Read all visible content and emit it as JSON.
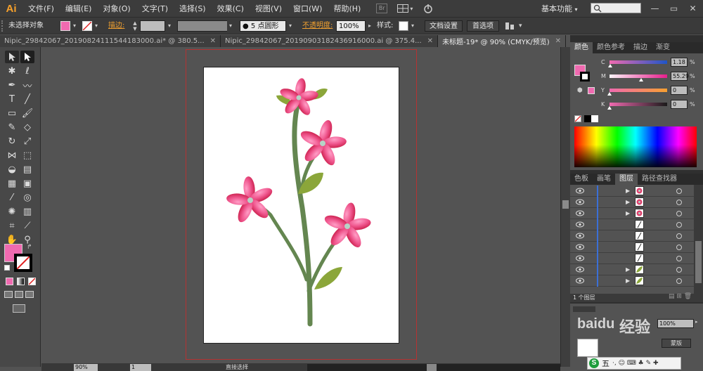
{
  "app": {
    "logo": "Ai",
    "workspace": "基本功能"
  },
  "menubar": {
    "items": [
      "文件(F)",
      "编辑(E)",
      "对象(O)",
      "文字(T)",
      "选择(S)",
      "效果(C)",
      "视图(V)",
      "窗口(W)",
      "帮助(H)"
    ],
    "bridge_label": "Br"
  },
  "window_buttons": {
    "minimize": "—",
    "restore": "▭",
    "close": "✕"
  },
  "control_bar": {
    "selection_label": "未选择对象",
    "stroke_label": "描边:",
    "brush_label": "5 点圆形",
    "opacity_label": "不透明度:",
    "opacity_value": "100%",
    "style_label": "样式:",
    "doc_setup_button": "文档设置",
    "preferences_button": "首选项"
  },
  "tabs": [
    {
      "label": "Nipic_29842067_20190824111544183000.ai* @ 380.5...",
      "active": false
    },
    {
      "label": "Nipic_29842067_20190903182436916000.ai @ 375.4...",
      "active": false
    },
    {
      "label": "未标题-19* @ 90% (CMYK/预览)",
      "active": true
    }
  ],
  "color_panel": {
    "tabs": [
      "颜色",
      "颜色参考",
      "描边",
      "渐变"
    ],
    "channels": [
      {
        "label": "C",
        "value": "1.18",
        "unit": "%",
        "level": 0.0118
      },
      {
        "label": "M",
        "value": "55.29",
        "unit": "%",
        "level": 0.5529
      },
      {
        "label": "Y",
        "value": "0",
        "unit": "%",
        "level": 0
      },
      {
        "label": "K",
        "value": "0",
        "unit": "%",
        "level": 0
      }
    ],
    "fill_color": "#f06ab0"
  },
  "layers_panel": {
    "tabs": [
      "色板",
      "画笔",
      "图层",
      "路径查找器"
    ],
    "rows": [
      {
        "expand": true,
        "thumb": "flower"
      },
      {
        "expand": true,
        "thumb": "flower"
      },
      {
        "expand": true,
        "thumb": "flower"
      },
      {
        "expand": false,
        "thumb": "line"
      },
      {
        "expand": false,
        "thumb": "line"
      },
      {
        "expand": false,
        "thumb": "line"
      },
      {
        "expand": false,
        "thumb": "line"
      },
      {
        "expand": true,
        "thumb": "leaf"
      },
      {
        "expand": true,
        "thumb": "leaf"
      }
    ],
    "footer": "1 个图层"
  },
  "watermark": {
    "text": "经验",
    "pct": "100%",
    "btn": "蒙版"
  },
  "ime": {
    "label": "五",
    "icons": "·, ☺ ⌨ ♣ ✎ ✚"
  },
  "status": {
    "zoom": "90%",
    "page": "1",
    "tool": "直接选择"
  }
}
